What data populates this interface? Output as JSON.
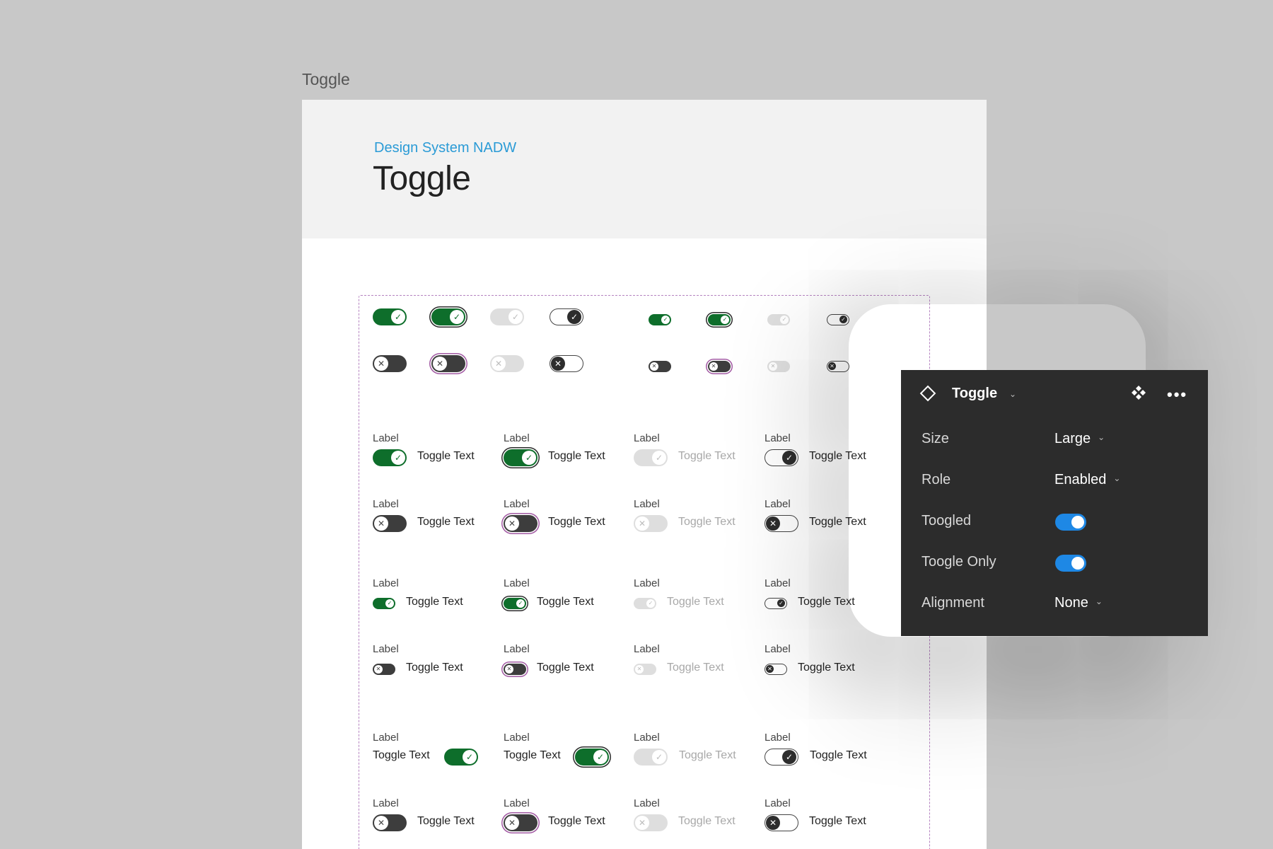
{
  "canvas": {
    "frame_label": "Toggle"
  },
  "doc": {
    "eyebrow": "Design System NADW",
    "title": "Toggle"
  },
  "item": {
    "label": "Label",
    "toggle_text": "Toggle Text"
  },
  "colors": {
    "on": "#0e6e2b",
    "off": "#3d3d3d",
    "disabled": "#dedede",
    "focus_ring": "#a25aa3",
    "accent": "#1e88e5",
    "eyebrow": "#2b9bd6",
    "panel_bg": "#2c2c2c"
  },
  "icons": {
    "checked_knob": "check-icon",
    "unchecked_knob": "x-icon",
    "component": "diamond-icon",
    "instance": "component-instance-icon",
    "more": "more-horizontal-icon",
    "dropdown": "chevron-down-icon"
  },
  "panel": {
    "title": "Toggle",
    "properties": {
      "size": {
        "label": "Size",
        "value": "Large"
      },
      "role": {
        "label": "Role",
        "value": "Enabled"
      },
      "toggled": {
        "label": "Toogled",
        "value": true
      },
      "toggle_only": {
        "label": "Toogle Only",
        "value": true
      },
      "alignment": {
        "label": "Alignment",
        "value": "None"
      }
    }
  }
}
